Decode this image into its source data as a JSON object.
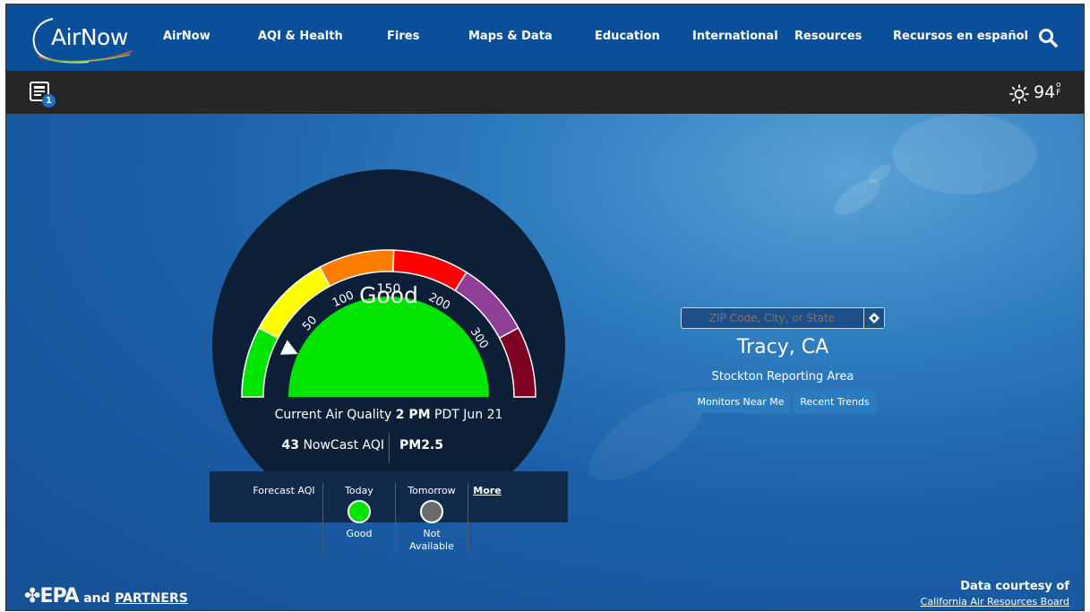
{
  "logo": {
    "text": "AirNow"
  },
  "nav": {
    "items": [
      "AirNow",
      "AQI & Health",
      "Fires",
      "Maps & Data",
      "Education",
      "International",
      "Resources",
      "Recursos en español"
    ]
  },
  "toolbar": {
    "notification_count": "1",
    "temperature": "94",
    "unit_top": "o",
    "unit_bottom": "F"
  },
  "gauge": {
    "status": "Good",
    "current_label": "Current Air Quality",
    "current_time": "2 PM",
    "current_date": "PDT Jun 21",
    "aqi_value": "43",
    "aqi_label": "NowCast AQI",
    "pollutant": "PM2.5",
    "ticks": [
      "50",
      "100",
      "150",
      "200",
      "300"
    ],
    "aqi_level": 43
  },
  "forecast": {
    "label": "Forecast AQI",
    "today_label": "Today",
    "today_value": "Good",
    "tomorrow_label": "Tomorrow",
    "tomorrow_value_1": "Not",
    "tomorrow_value_2": "Available",
    "more_link": "More"
  },
  "location": {
    "search_placeholder": "ZIP Code, City, or State",
    "city": "Tracy, CA",
    "area": "Stockton Reporting Area",
    "buttons": [
      "Monitors Near Me",
      "Recent Trends"
    ]
  },
  "footer": {
    "epa": "EPA",
    "and": "and",
    "partners": "PARTNERS",
    "courtesy": "Data courtesy of",
    "source": "California Air Resources Board"
  },
  "colors": {
    "good": "#00e400",
    "moderate": "#ffff00",
    "usg": "#ff7e00",
    "unhealthy": "#ff0000",
    "very_unhealthy": "#8f3f97",
    "hazardous": "#7e0023"
  }
}
